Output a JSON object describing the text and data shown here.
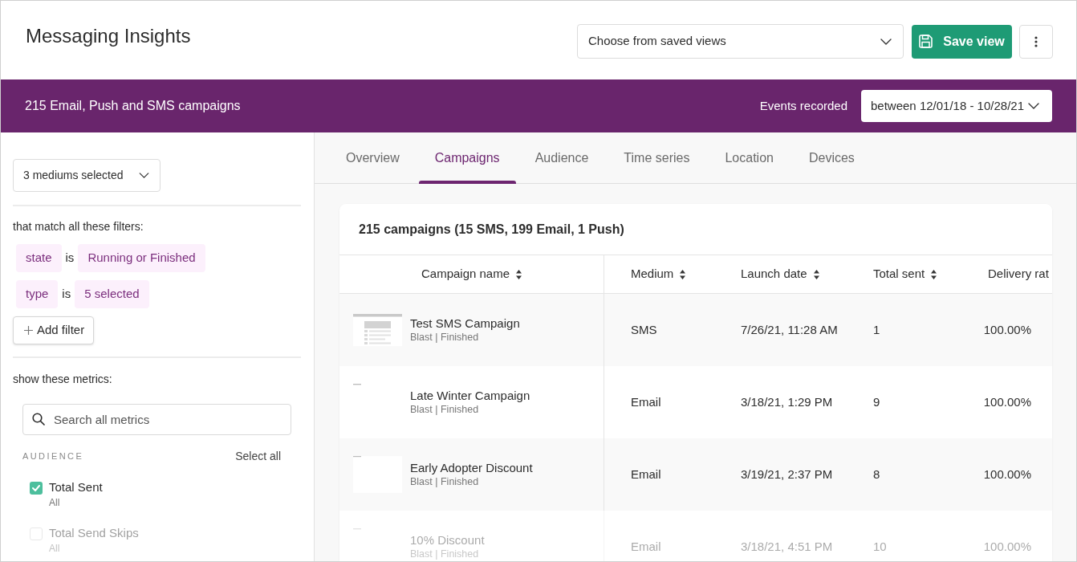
{
  "header": {
    "title": "Messaging Insights",
    "saved_views_dropdown": {
      "label": "Choose from saved views"
    },
    "save_button": "Save view"
  },
  "banner": {
    "title": "215 Email, Push and SMS campaigns",
    "events_label": "Events recorded",
    "date_range": "between 12/01/18 - 10/28/21"
  },
  "sidebar": {
    "medium_select": "3 mediums selected",
    "filters_heading": "that match all these filters:",
    "filters": [
      {
        "field": "state",
        "operator": "is",
        "value": "Running or Finished"
      },
      {
        "field": "type",
        "operator": "is",
        "value": "5 selected"
      }
    ],
    "add_filter": "Add filter",
    "metrics_heading": "show these metrics:",
    "metric_search": {
      "placeholder": "Search all metrics"
    },
    "metric_group": {
      "title": "AUDIENCE",
      "select_all": "Select all",
      "metrics": [
        {
          "label": "Total Sent",
          "subtitle": "All",
          "checked": true,
          "faded": false
        },
        {
          "label": "Total Send Skips",
          "subtitle": "All",
          "checked": false,
          "faded": true
        }
      ]
    }
  },
  "tabs": [
    {
      "label": "Overview",
      "selected": false
    },
    {
      "label": "Campaigns",
      "selected": true
    },
    {
      "label": "Audience",
      "selected": false
    },
    {
      "label": "Time series",
      "selected": false
    },
    {
      "label": "Location",
      "selected": false
    },
    {
      "label": "Devices",
      "selected": false
    }
  ],
  "campaigns_table": {
    "title": "215 campaigns (15 SMS, 199 Email, 1 Push)",
    "columns": [
      {
        "label": "Campaign name",
        "sortable": true
      },
      {
        "label": "Medium",
        "sortable": true
      },
      {
        "label": "Launch date",
        "sortable": true
      },
      {
        "label": "Total sent",
        "sortable": true
      },
      {
        "label": "Delivery rat",
        "sortable": false
      }
    ],
    "rows": [
      {
        "kind": "document",
        "name": "Test SMS Campaign",
        "subtitle": "Blast | Finished",
        "medium": "SMS",
        "launch_date": "7/26/21, 11:28 AM",
        "total_sent": "1",
        "delivery_rate": "100.00%",
        "faded": false
      },
      {
        "kind": "empty",
        "name": "Late Winter Campaign",
        "subtitle": "Blast | Finished",
        "medium": "Email",
        "launch_date": "3/18/21, 1:29 PM",
        "total_sent": "9",
        "delivery_rate": "100.00%",
        "faded": false
      },
      {
        "kind": "blank",
        "name": "Early Adopter Discount",
        "subtitle": "Blast | Finished",
        "medium": "Email",
        "launch_date": "3/19/21, 2:37 PM",
        "total_sent": "8",
        "delivery_rate": "100.00%",
        "faded": false
      },
      {
        "kind": "empty",
        "name": "10% Discount",
        "subtitle": "Blast | Finished",
        "medium": "Email",
        "launch_date": "3/18/21, 4:51 PM",
        "total_sent": "10",
        "delivery_rate": "100.00%",
        "faded": true
      }
    ]
  }
}
